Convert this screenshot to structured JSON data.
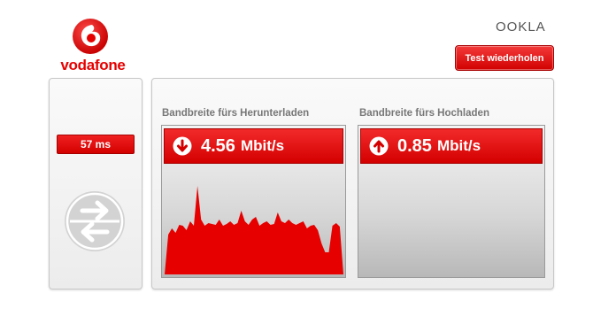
{
  "brand": {
    "name": "vodafone",
    "provider": "OOKLA",
    "accent_color": "#e60000"
  },
  "toolbar": {
    "retest_label": "Test wiederholen"
  },
  "ping": {
    "value": "57 ms"
  },
  "download": {
    "label": "Bandbreite fürs Herunterladen",
    "value": "4.56",
    "unit": "Mbit/s",
    "icon": "arrow-down-icon",
    "graph_samples": [
      0.0,
      0.45,
      0.52,
      0.47,
      0.56,
      0.55,
      0.5,
      0.6,
      0.55,
      1.0,
      0.62,
      0.55,
      0.58,
      0.57,
      0.56,
      0.62,
      0.55,
      0.57,
      0.6,
      0.56,
      0.58,
      0.72,
      0.6,
      0.56,
      0.62,
      0.65,
      0.55,
      0.58,
      0.6,
      0.56,
      0.57,
      0.7,
      0.6,
      0.58,
      0.62,
      0.58,
      0.56,
      0.58,
      0.6,
      0.52,
      0.55,
      0.56,
      0.5,
      0.35,
      0.25,
      0.25,
      0.55,
      0.58,
      0.54,
      0.0
    ]
  },
  "upload": {
    "label": "Bandbreite fürs Hochladen",
    "value": "0.85",
    "unit": "Mbit/s",
    "icon": "arrow-up-icon"
  }
}
